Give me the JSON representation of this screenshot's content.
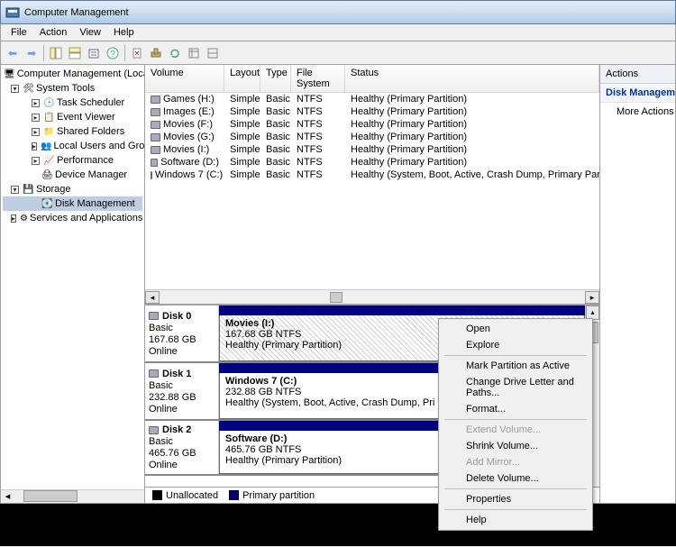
{
  "title": "Computer Management",
  "menus": [
    "File",
    "Action",
    "View",
    "Help"
  ],
  "tree": {
    "root": "Computer Management (Local)",
    "systools": "System Tools",
    "st_items": [
      "Task Scheduler",
      "Event Viewer",
      "Shared Folders",
      "Local Users and Groups",
      "Performance",
      "Device Manager"
    ],
    "storage": "Storage",
    "diskmgmt": "Disk Management",
    "services": "Services and Applications"
  },
  "vol_cols": {
    "c0": "Volume",
    "c1": "Layout",
    "c2": "Type",
    "c3": "File System",
    "c4": "Status"
  },
  "volumes": [
    {
      "name": "Games (H:)",
      "layout": "Simple",
      "type": "Basic",
      "fs": "NTFS",
      "status": "Healthy (Primary Partition)"
    },
    {
      "name": "Images (E:)",
      "layout": "Simple",
      "type": "Basic",
      "fs": "NTFS",
      "status": "Healthy (Primary Partition)"
    },
    {
      "name": "Movies (F:)",
      "layout": "Simple",
      "type": "Basic",
      "fs": "NTFS",
      "status": "Healthy (Primary Partition)"
    },
    {
      "name": "Movies (G:)",
      "layout": "Simple",
      "type": "Basic",
      "fs": "NTFS",
      "status": "Healthy (Primary Partition)"
    },
    {
      "name": "Movies (I:)",
      "layout": "Simple",
      "type": "Basic",
      "fs": "NTFS",
      "status": "Healthy (Primary Partition)"
    },
    {
      "name": "Software (D:)",
      "layout": "Simple",
      "type": "Basic",
      "fs": "NTFS",
      "status": "Healthy (Primary Partition)"
    },
    {
      "name": "Windows 7 (C:)",
      "layout": "Simple",
      "type": "Basic",
      "fs": "NTFS",
      "status": "Healthy (System, Boot, Active, Crash Dump, Primary Partition)"
    }
  ],
  "disks": [
    {
      "title": "Disk 0",
      "type": "Basic",
      "size": "167.68 GB",
      "status": "Online",
      "pname": "Movies  (I:)",
      "psize": "167.68 GB NTFS",
      "pstatus": "Healthy (Primary Partition)",
      "hatched": true
    },
    {
      "title": "Disk 1",
      "type": "Basic",
      "size": "232.88 GB",
      "status": "Online",
      "pname": "Windows 7  (C:)",
      "psize": "232.88 GB NTFS",
      "pstatus": "Healthy (System, Boot, Active, Crash Dump, Pri",
      "hatched": false
    },
    {
      "title": "Disk 2",
      "type": "Basic",
      "size": "465.76 GB",
      "status": "Online",
      "pname": "Software  (D:)",
      "psize": "465.76 GB NTFS",
      "pstatus": "Healthy (Primary Partition)",
      "hatched": false
    }
  ],
  "legend": {
    "unalloc": "Unallocated",
    "primary": "Primary partition"
  },
  "actions": {
    "header": "Actions",
    "sub": "Disk Management",
    "more": "More Actions"
  },
  "ctx": {
    "open": "Open",
    "explore": "Explore",
    "mark": "Mark Partition as Active",
    "letter": "Change Drive Letter and Paths...",
    "format": "Format...",
    "extend": "Extend Volume...",
    "shrink": "Shrink Volume...",
    "mirror": "Add Mirror...",
    "delete": "Delete Volume...",
    "prop": "Properties",
    "help": "Help"
  }
}
